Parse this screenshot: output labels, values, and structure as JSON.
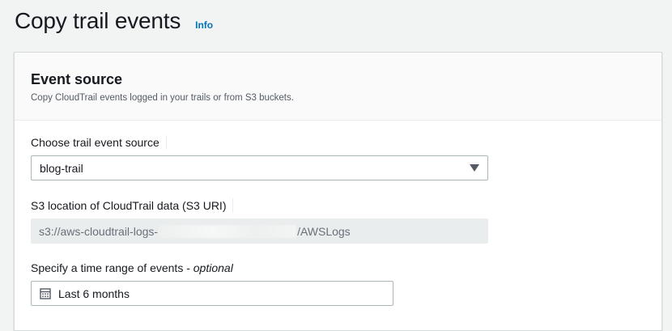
{
  "header": {
    "title": "Copy trail events",
    "info_link": "Info"
  },
  "section": {
    "title": "Event source",
    "description": "Copy CloudTrail events logged in your trails or from S3 buckets."
  },
  "fields": {
    "trail_source": {
      "label": "Choose trail event source",
      "value": "blog-trail",
      "icon": "caret-down-icon"
    },
    "s3_location": {
      "label": "S3 location of CloudTrail data (S3 URI)",
      "value_prefix": "s3://aws-cloudtrail-logs-",
      "value_suffix": "/AWSLogs"
    },
    "time_range": {
      "label": "Specify a time range of events - ",
      "label_optional": "optional",
      "value": "Last 6 months",
      "icon": "calendar-icon"
    }
  },
  "colors": {
    "background": "#f2f3f3",
    "link": "#0073bb",
    "readonly_bg": "#eaeded",
    "border": "#aab7b8"
  }
}
